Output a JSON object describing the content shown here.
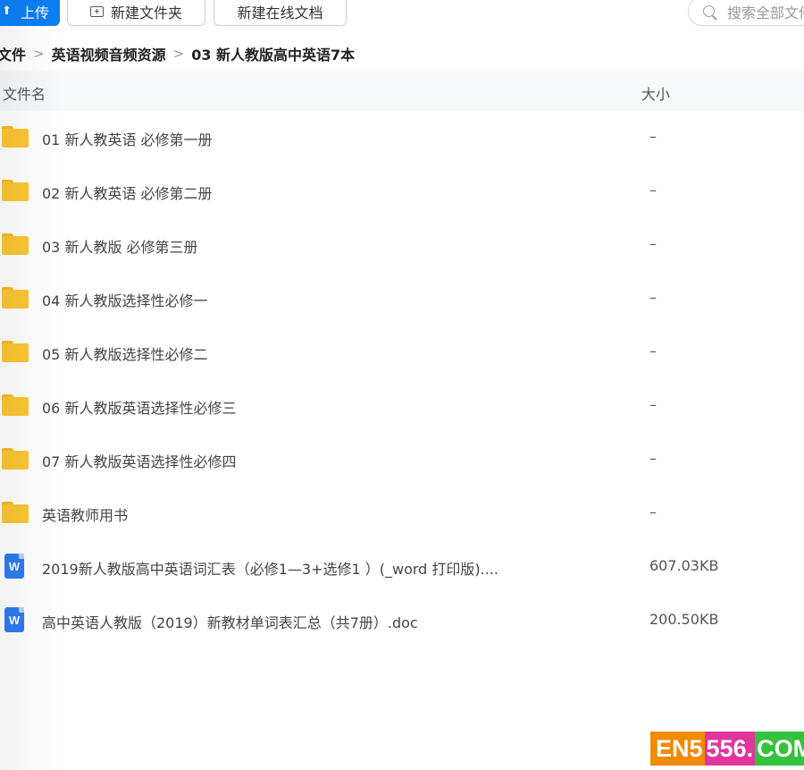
{
  "toolbar": {
    "upload_label": "上传",
    "new_folder_label": "新建文件夹",
    "new_doc_label": "新建在线文档",
    "search_placeholder": "搜索全部文件"
  },
  "breadcrumb": [
    "文件",
    "英语视频音频资源",
    "03 新人教版高中英语7本"
  ],
  "header": {
    "name": "文件名",
    "size": "大小"
  },
  "files": [
    {
      "type": "folder",
      "name": "01 新人教英语 必修第一册",
      "size": "–"
    },
    {
      "type": "folder",
      "name": "02 新人教英语 必修第二册",
      "size": "–"
    },
    {
      "type": "folder",
      "name": "03 新人教版 必修第三册",
      "size": "–"
    },
    {
      "type": "folder",
      "name": "04 新人教版选择性必修一",
      "size": "–"
    },
    {
      "type": "folder",
      "name": "05 新人教版选择性必修二",
      "size": "–"
    },
    {
      "type": "folder",
      "name": "06 新人教版英语选择性必修三",
      "size": "–"
    },
    {
      "type": "folder",
      "name": "07 新人教版英语选择性必修四",
      "size": "–"
    },
    {
      "type": "folder",
      "name": "英语教师用书",
      "size": "–"
    },
    {
      "type": "word",
      "name": "2019新人教版高中英语词汇表（必修1—3+选修1 ）(_word 打印版)....",
      "size": "607.03KB"
    },
    {
      "type": "word",
      "name": "高中英语人教版（2019）新教材单词表汇总（共7册）.doc",
      "size": "200.50KB"
    }
  ],
  "watermark": {
    "part1": "EN5",
    "part2": "556.",
    "part3": "COM"
  },
  "colors": {
    "accent": "#0b7ff5",
    "folder": "#fbc634",
    "word": "#2f7bf2"
  },
  "icons": [
    "upload-icon",
    "folder-plus-icon",
    "search-icon",
    "chevron-right-icon",
    "folder-icon",
    "word-doc-icon"
  ]
}
